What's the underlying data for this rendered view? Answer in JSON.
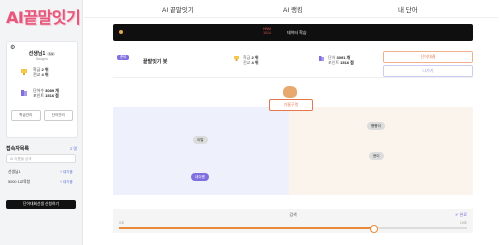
{
  "app": {
    "logo": "AI끝말잇기"
  },
  "nav": {
    "items": [
      "AI 끝말잇기",
      "AI 랭킹",
      "내 단어"
    ]
  },
  "profile": {
    "name": "선생님1",
    "level": "Lv",
    "subtitle": "Badges",
    "rank_label": "학급",
    "rank_value": "2 위",
    "school_label": "전교",
    "school_value": "4 위",
    "words_label": "단어수",
    "words_value": "3089 개",
    "points_label": "포인트",
    "points_value": "1516 점",
    "btn_left": "학급관리",
    "btn_right": "단어관리"
  },
  "access": {
    "title": "접속자목록",
    "count": "2 명",
    "search_placeholder": "AI 이름을 검색",
    "users": [
      {
        "name": "선생님1",
        "action": "+ 대기중"
      },
      {
        "name": "5000 1교육청",
        "action": "+ 대기중"
      }
    ],
    "apply_button": "단어대회선생 신청하기"
  },
  "banner": {
    "tag_top": "HNM",
    "tag_bottom": "1014 ",
    "text": "데이터 학습"
  },
  "card": {
    "tag": "준비",
    "title": "끝말잇기 봇",
    "stat1_label": "학급",
    "stat1_value": "2 위",
    "stat2_label": "전교",
    "stat2_value": "4 위",
    "stat3_label": "단어",
    "stat3_value": "3091 개",
    "stat4_label": "포인트",
    "stat4_value": "1516 점",
    "btn_primary": "단어대결",
    "btn_secondary": "나가기"
  },
  "board": {
    "center_word": "기름구멍",
    "words": [
      "이탈",
      "내이름",
      "빵빵이",
      "현이"
    ]
  },
  "slider": {
    "label": "검색",
    "check": "✔ 완료",
    "min": "0초",
    "max": "10초",
    "value": 0.73
  },
  "colors": {
    "accent": "#7f6fe0",
    "orange": "#e98a3a",
    "pink": "#e4567a"
  }
}
